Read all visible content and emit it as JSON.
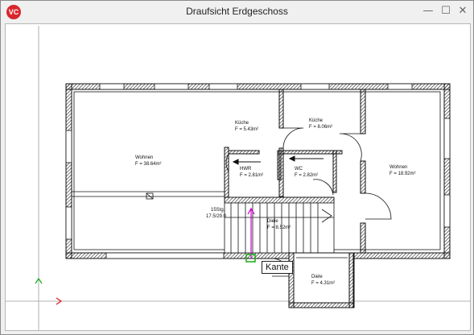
{
  "window": {
    "title": "Draufsicht Erdgeschoss",
    "logo_text": "VC",
    "controls": {
      "minimize": "—",
      "maximize": "☐",
      "close": "✕"
    }
  },
  "plan": {
    "rooms": [
      {
        "name": "Wohnen",
        "area": "F = 38.64m²"
      },
      {
        "name": "Küche",
        "area": "F = 5.43m²"
      },
      {
        "name": "Küche",
        "area": "F = 8.06m²"
      },
      {
        "name": "Wohnen",
        "area": "F = 18.92m²"
      },
      {
        "name": "HWR",
        "area": "F = 2.81m²"
      },
      {
        "name": "WC",
        "area": "F = 2.82m²"
      },
      {
        "name": "Diele",
        "area": "F = 8.52m²"
      },
      {
        "name": "Diele",
        "area": "F = 4.31m²"
      }
    ],
    "stair_label_1": "15Stg.",
    "stair_label_2": "17.5/29.0",
    "snap_tooltip": "Kante",
    "colors": {
      "wall": "#111111",
      "axis_y": "#18a818",
      "axis_x": "#e01818",
      "cursor": "#cc00cc",
      "snap": "#18a818"
    }
  }
}
